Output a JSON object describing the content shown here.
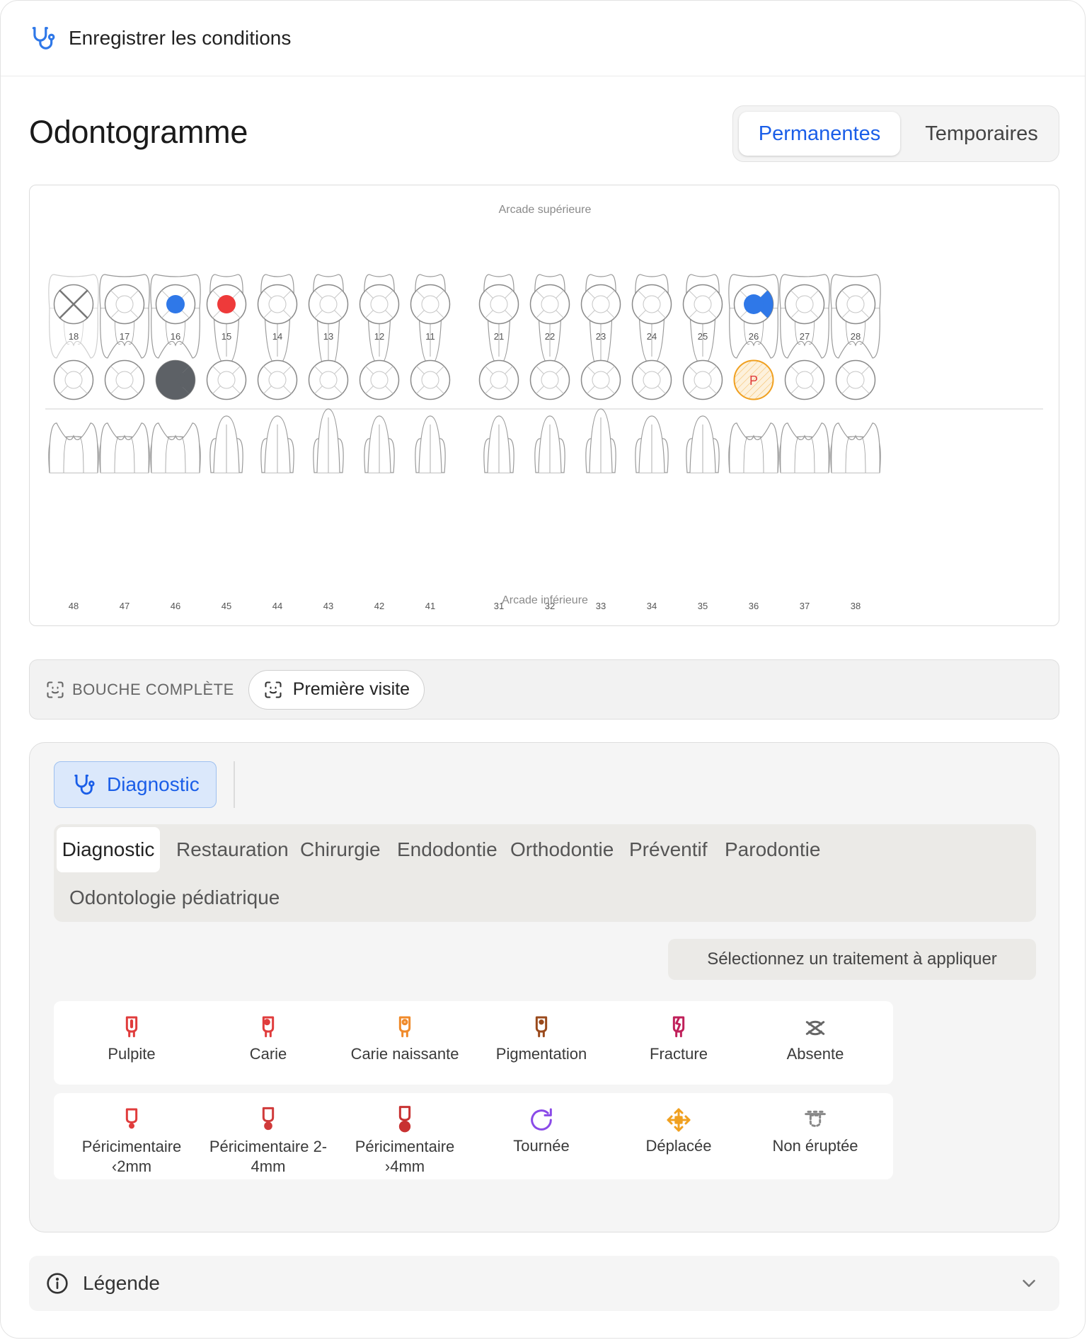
{
  "header": {
    "title": "Enregistrer les conditions"
  },
  "page": {
    "title": "Odontogramme",
    "dentition": {
      "options": [
        "Permanentes",
        "Temporaires"
      ],
      "selected": "Permanentes"
    }
  },
  "odontogram": {
    "upper_label": "Arcade supérieure",
    "lower_label": "Arcade inférieure",
    "upper_teeth": [
      {
        "num": "18",
        "status": "absent"
      },
      {
        "num": "17",
        "status": "normal"
      },
      {
        "num": "16",
        "status": "full",
        "color": "#2f78e8"
      },
      {
        "num": "15",
        "status": "full",
        "color": "#ee3a3a"
      },
      {
        "num": "14",
        "status": "normal"
      },
      {
        "num": "13",
        "status": "normal"
      },
      {
        "num": "12",
        "status": "normal"
      },
      {
        "num": "11",
        "status": "normal"
      },
      {
        "num": "21",
        "status": "normal"
      },
      {
        "num": "22",
        "status": "normal"
      },
      {
        "num": "23",
        "status": "normal"
      },
      {
        "num": "24",
        "status": "normal"
      },
      {
        "num": "25",
        "status": "normal"
      },
      {
        "num": "26",
        "status": "partial",
        "color": "#2f78e8"
      },
      {
        "num": "27",
        "status": "normal"
      },
      {
        "num": "28",
        "status": "normal"
      }
    ],
    "lower_teeth": [
      {
        "num": "48",
        "status": "normal"
      },
      {
        "num": "47",
        "status": "normal"
      },
      {
        "num": "46",
        "status": "partial",
        "color": "#5d6166"
      },
      {
        "num": "45",
        "status": "normal"
      },
      {
        "num": "44",
        "status": "normal"
      },
      {
        "num": "43",
        "status": "normal"
      },
      {
        "num": "42",
        "status": "normal"
      },
      {
        "num": "41",
        "status": "normal"
      },
      {
        "num": "31",
        "status": "normal"
      },
      {
        "num": "32",
        "status": "normal"
      },
      {
        "num": "33",
        "status": "normal"
      },
      {
        "num": "34",
        "status": "normal"
      },
      {
        "num": "35",
        "status": "normal"
      },
      {
        "num": "36",
        "status": "marked",
        "color": "#f0a020",
        "mark": "P"
      },
      {
        "num": "37",
        "status": "normal"
      },
      {
        "num": "38",
        "status": "normal"
      }
    ]
  },
  "mouth": {
    "label": "BOUCHE COMPLÈTE",
    "visit_button": "Première visite"
  },
  "treatment": {
    "mode_button": "Diagnostic",
    "categories": [
      "Diagnostic",
      "Restauration",
      "Chirurgie",
      "Endodontie",
      "Orthodontie",
      "Préventif",
      "Parodontie",
      "Odontologie pédiatrique"
    ],
    "active_category": "Diagnostic",
    "hint": "Sélectionnez un traitement à appliquer",
    "items": [
      {
        "label": "Pulpite",
        "icon": "tooth-pulp-icon",
        "color": "#e03c3c",
        "badge": false
      },
      {
        "label": "Carie",
        "icon": "tooth-caries-icon",
        "color": "#e03c3c",
        "badge": true
      },
      {
        "label": "Carie naissante",
        "icon": "tooth-incipient-caries-icon",
        "color": "#f08a2a",
        "badge": true
      },
      {
        "label": "Pigmentation",
        "icon": "tooth-pigmentation-icon",
        "color": "#9a4a1c",
        "badge": true
      },
      {
        "label": "Fracture",
        "icon": "tooth-fracture-icon",
        "color": "#c0205a",
        "badge": false
      },
      {
        "label": "Absente",
        "icon": "tooth-absent-icon",
        "color": "#666666",
        "badge": false
      },
      {
        "label": "Péricimentaire\n‹2mm",
        "icon": "periapical-small-icon",
        "color": "#e03c3c",
        "badge": false
      },
      {
        "label": "Péricimentaire 2-\n4mm",
        "icon": "periapical-medium-icon",
        "color": "#d03a3a",
        "badge": false
      },
      {
        "label": "Péricimentaire\n›4mm",
        "icon": "periapical-large-icon",
        "color": "#c83232",
        "badge": false
      },
      {
        "label": "Tournée",
        "icon": "rotate-icon",
        "color": "#8a4ae8",
        "badge": false
      },
      {
        "label": "Déplacée",
        "icon": "move-icon",
        "color": "#f0a020",
        "badge": false
      },
      {
        "label": "Non éruptée",
        "icon": "unerupted-icon",
        "color": "#888888",
        "badge": false
      }
    ]
  },
  "legend": {
    "label": "Légende"
  }
}
